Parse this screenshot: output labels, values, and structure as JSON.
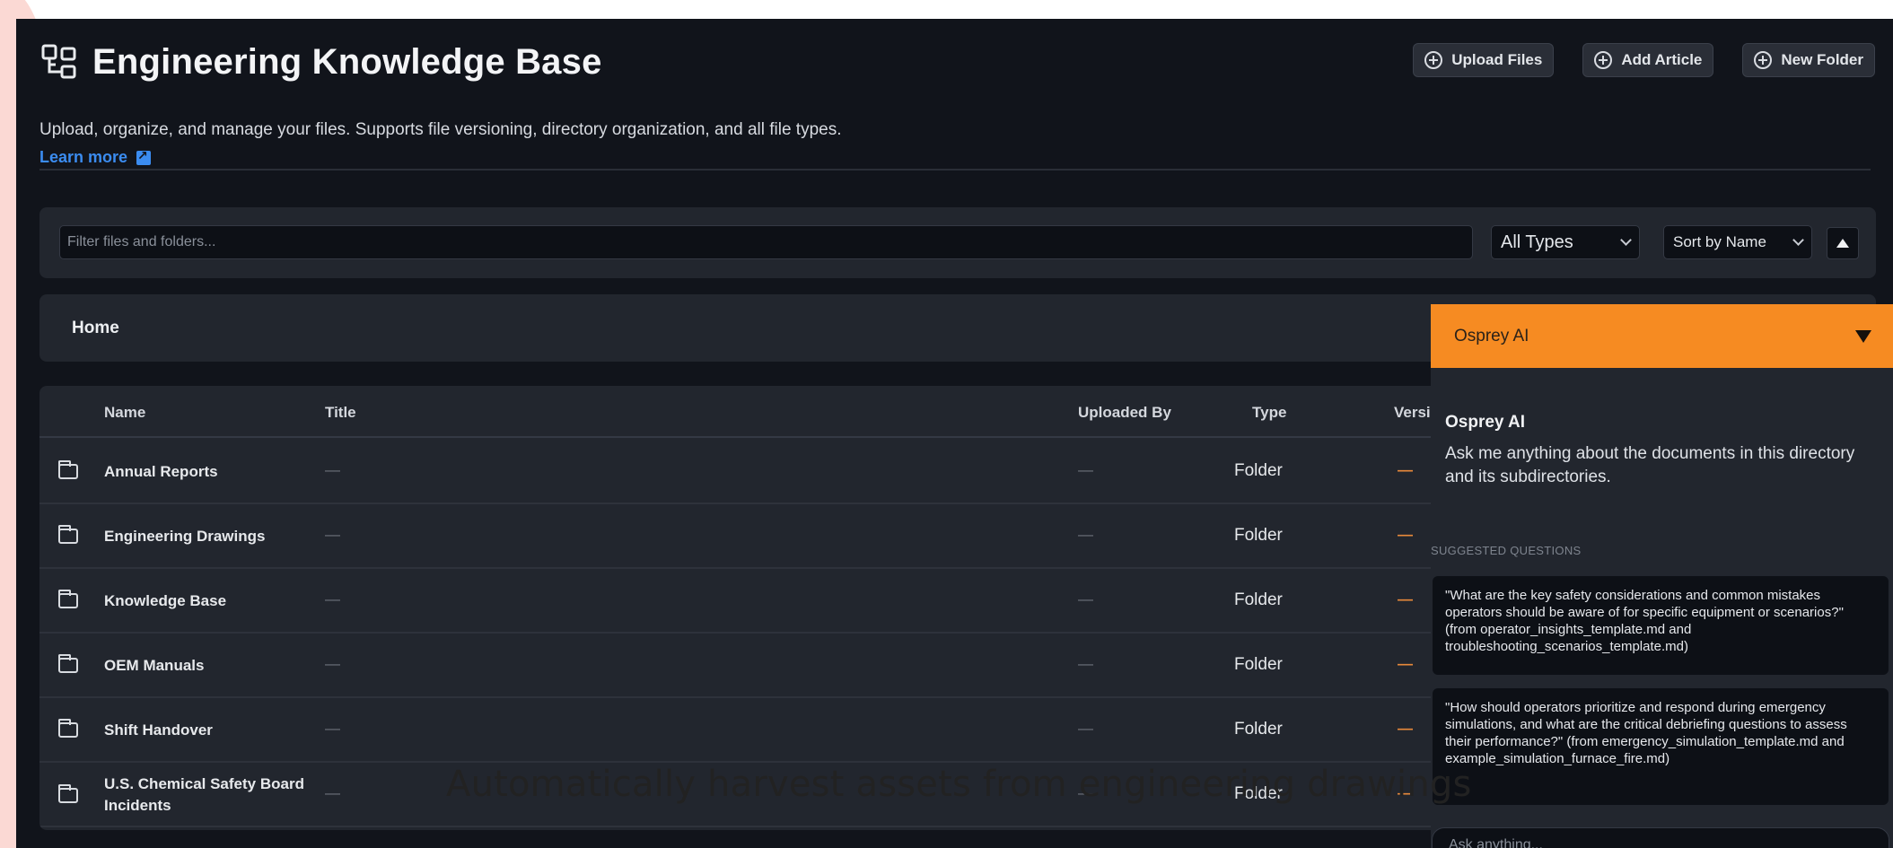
{
  "header": {
    "title": "Engineering Knowledge Base",
    "subtitle": "Upload, organize, and manage your files. Supports file versioning, directory organization, and all file types.",
    "learn_more": "Learn more",
    "actions": {
      "upload": "Upload Files",
      "add_article": "Add Article",
      "new_folder": "New Folder"
    }
  },
  "filters": {
    "search_placeholder": "Filter files and folders...",
    "type_select": "All Types",
    "sort_select": "Sort by Name"
  },
  "breadcrumb": {
    "home": "Home"
  },
  "table": {
    "columns": {
      "name": "Name",
      "title": "Title",
      "uploaded_by": "Uploaded By",
      "type": "Type",
      "version": "Version"
    },
    "rows": [
      {
        "name": "Annual Reports",
        "title": "—",
        "uploaded_by": "—",
        "type": "Folder",
        "version": "—"
      },
      {
        "name": "Engineering Drawings",
        "title": "—",
        "uploaded_by": "—",
        "type": "Folder",
        "version": "—"
      },
      {
        "name": "Knowledge Base",
        "title": "—",
        "uploaded_by": "—",
        "type": "Folder",
        "version": "—"
      },
      {
        "name": "OEM Manuals",
        "title": "—",
        "uploaded_by": "—",
        "type": "Folder",
        "version": "—"
      },
      {
        "name": "Shift Handover",
        "title": "—",
        "uploaded_by": "—",
        "type": "Folder",
        "version": "—"
      },
      {
        "name": "U.S. Chemical Safety Board Incidents",
        "title": "—",
        "uploaded_by": "—",
        "type": "Folder",
        "version": "—"
      }
    ]
  },
  "chat": {
    "header_title": "Osprey AI",
    "intro_title": "Osprey AI",
    "intro_text": "Ask me anything about the documents in this directory and its subdirectories.",
    "section_label": "SUGGESTED QUESTIONS",
    "suggestions": [
      "\"What are the key safety considerations and common mistakes operators should be aware of for specific equipment or scenarios?\" (from operator_insights_template.md and troubleshooting_scenarios_template.md)",
      "\"How should operators prioritize and respond during emergency simulations, and what are the critical debriefing questions to assess their performance?\" (from emergency_simulation_template.md and example_simulation_furnace_fire.md)"
    ],
    "input_placeholder": "Ask anything..."
  },
  "caption": "Automatically harvest assets from engineering drawings",
  "colors": {
    "background": "#11141b",
    "panel": "#22262e",
    "accent": "#f68b22",
    "link": "#3b8cf0",
    "version_dash": "#e8893b"
  }
}
